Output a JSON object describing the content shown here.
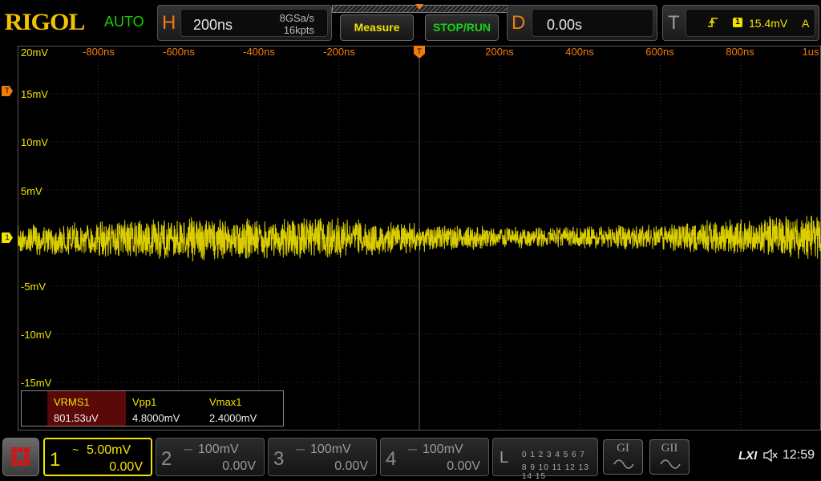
{
  "brand": "RIGOL",
  "trigger_status": "AUTO",
  "horizontal": {
    "key": "H",
    "timebase": "200ns",
    "sample_rate": "8GSa/s",
    "memory_depth": "16kpts"
  },
  "buttons": {
    "measure": "Measure",
    "stop_run": "STOP/RUN"
  },
  "delay": {
    "key": "D",
    "value": "0.00s"
  },
  "trigger": {
    "key": "T",
    "edge_icon": "rising-edge-icon",
    "source": "1",
    "level": "15.4mV",
    "mode": "A"
  },
  "grid": {
    "time_labels": [
      "-800ns",
      "-600ns",
      "-400ns",
      "-200ns",
      "200ns",
      "400ns",
      "600ns",
      "800ns",
      "1us"
    ],
    "volt_labels": [
      "20mV",
      "15mV",
      "10mV",
      "5mV",
      "-5mV",
      "-10mV",
      "-15mV"
    ],
    "ch1_marker": "1",
    "trig_marker": "T"
  },
  "measurements": [
    {
      "name": "VRMS1",
      "value": "801.53uV"
    },
    {
      "name": "Vpp1",
      "value": "4.8000mV"
    },
    {
      "name": "Vmax1",
      "value": "2.4000mV"
    }
  ],
  "channels": [
    {
      "num": "1",
      "coupling": "~",
      "scale": "5.00mV",
      "offset": "0.00V",
      "color": "#f2e200"
    },
    {
      "num": "2",
      "coupling": "⎓",
      "scale": "100mV",
      "offset": "0.00V",
      "color": "#9a9a9a"
    },
    {
      "num": "3",
      "coupling": "⎓",
      "scale": "100mV",
      "offset": "0.00V",
      "color": "#9a9a9a"
    },
    {
      "num": "4",
      "coupling": "⎓",
      "scale": "100mV",
      "offset": "0.00V",
      "color": "#9a9a9a"
    }
  ],
  "logic": {
    "key": "L",
    "row1": "0 1 2 3  4 5 6 7",
    "row2": "8 9 10 11 12 13 14 15"
  },
  "generators": [
    "GI",
    "GII"
  ],
  "status": {
    "lxi": "LXI",
    "time": "12:59"
  },
  "colors": {
    "ch1": "#f2e200",
    "orange": "#f27c0c",
    "green": "#16d000",
    "brand": "#f2c200"
  }
}
